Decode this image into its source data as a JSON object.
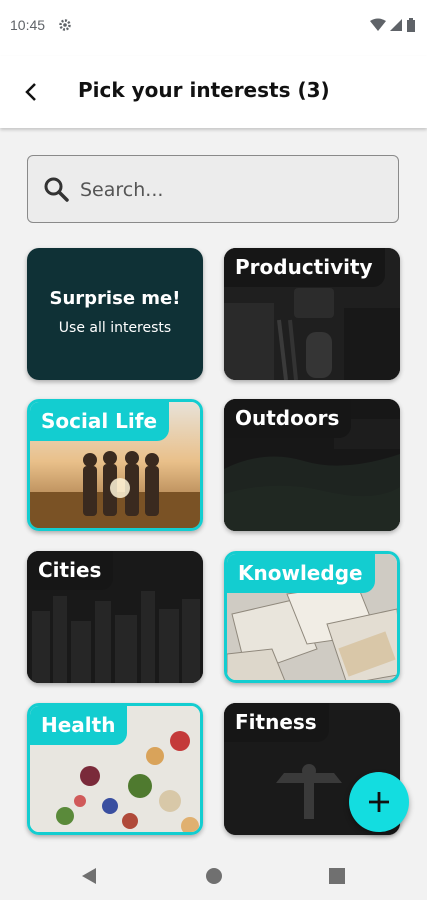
{
  "status": {
    "time": "10:45"
  },
  "header": {
    "title": "Pick your interests (3)"
  },
  "search": {
    "placeholder": "Search..."
  },
  "surprise": {
    "title": "Surprise me!",
    "subtitle": "Use all interests"
  },
  "cards": {
    "productivity": "Productivity",
    "social_life": "Social Life",
    "outdoors": "Outdoors",
    "cities": "Cities",
    "knowledge": "Knowledge",
    "health": "Health",
    "fitness": "Fitness"
  },
  "colors": {
    "accent": "#13cdd0",
    "fab": "#13dde0",
    "surprise_bg": "#0f3136"
  }
}
